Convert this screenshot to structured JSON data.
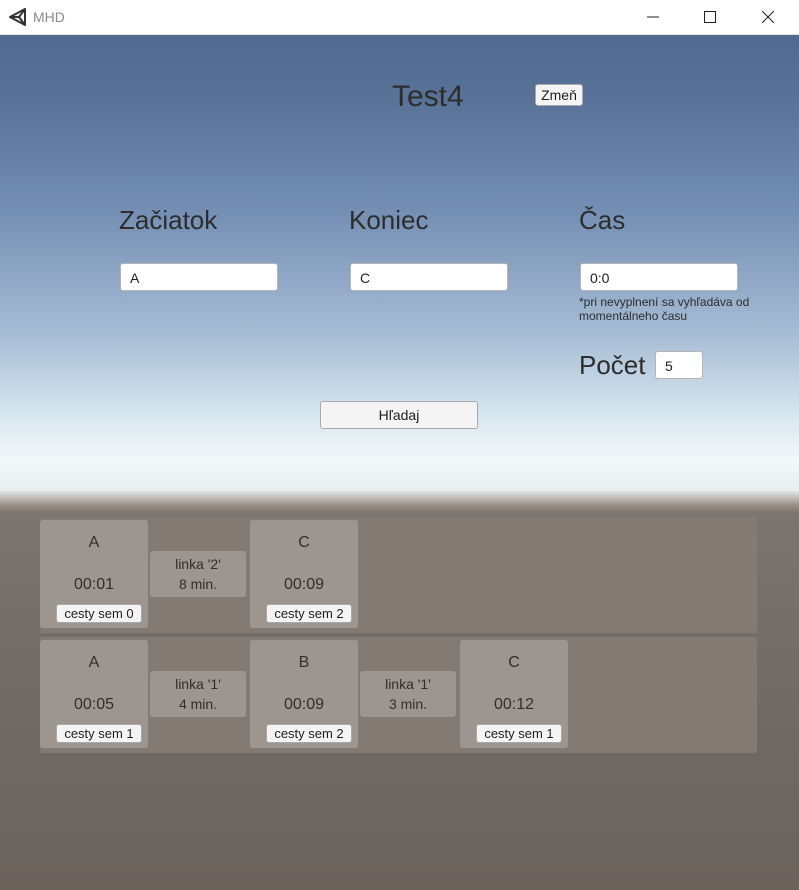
{
  "window": {
    "title": "MHD",
    "icons": [
      "unity-icon",
      "minimize-icon",
      "maximize-icon",
      "close-icon"
    ]
  },
  "header": {
    "title": "Test4",
    "change_button": "Zmeň"
  },
  "form": {
    "start_label": "Začiatok",
    "start_value": "A",
    "end_label": "Koniec",
    "end_value": "C",
    "time_label": "Čas",
    "time_value": "0:0",
    "time_note": "*pri nevyplnení sa vyhľadáva od momentálneho času",
    "count_label": "Počet",
    "count_value": "5",
    "search_button": "Hľadaj"
  },
  "results": [
    {
      "stops": [
        {
          "name": "A",
          "time": "00:01",
          "button": "cesty sem 0"
        },
        {
          "name": "C",
          "time": "00:09",
          "button": "cesty sem 2"
        }
      ],
      "legs": [
        {
          "line": "linka '2'",
          "duration": "8 min."
        }
      ]
    },
    {
      "stops": [
        {
          "name": "A",
          "time": "00:05",
          "button": "cesty sem 1"
        },
        {
          "name": "B",
          "time": "00:09",
          "button": "cesty sem 2"
        },
        {
          "name": "C",
          "time": "00:12",
          "button": "cesty sem 1"
        }
      ],
      "legs": [
        {
          "line": "linka '1'",
          "duration": "4 min."
        },
        {
          "line": "linka '1'",
          "duration": "3 min."
        }
      ]
    }
  ]
}
